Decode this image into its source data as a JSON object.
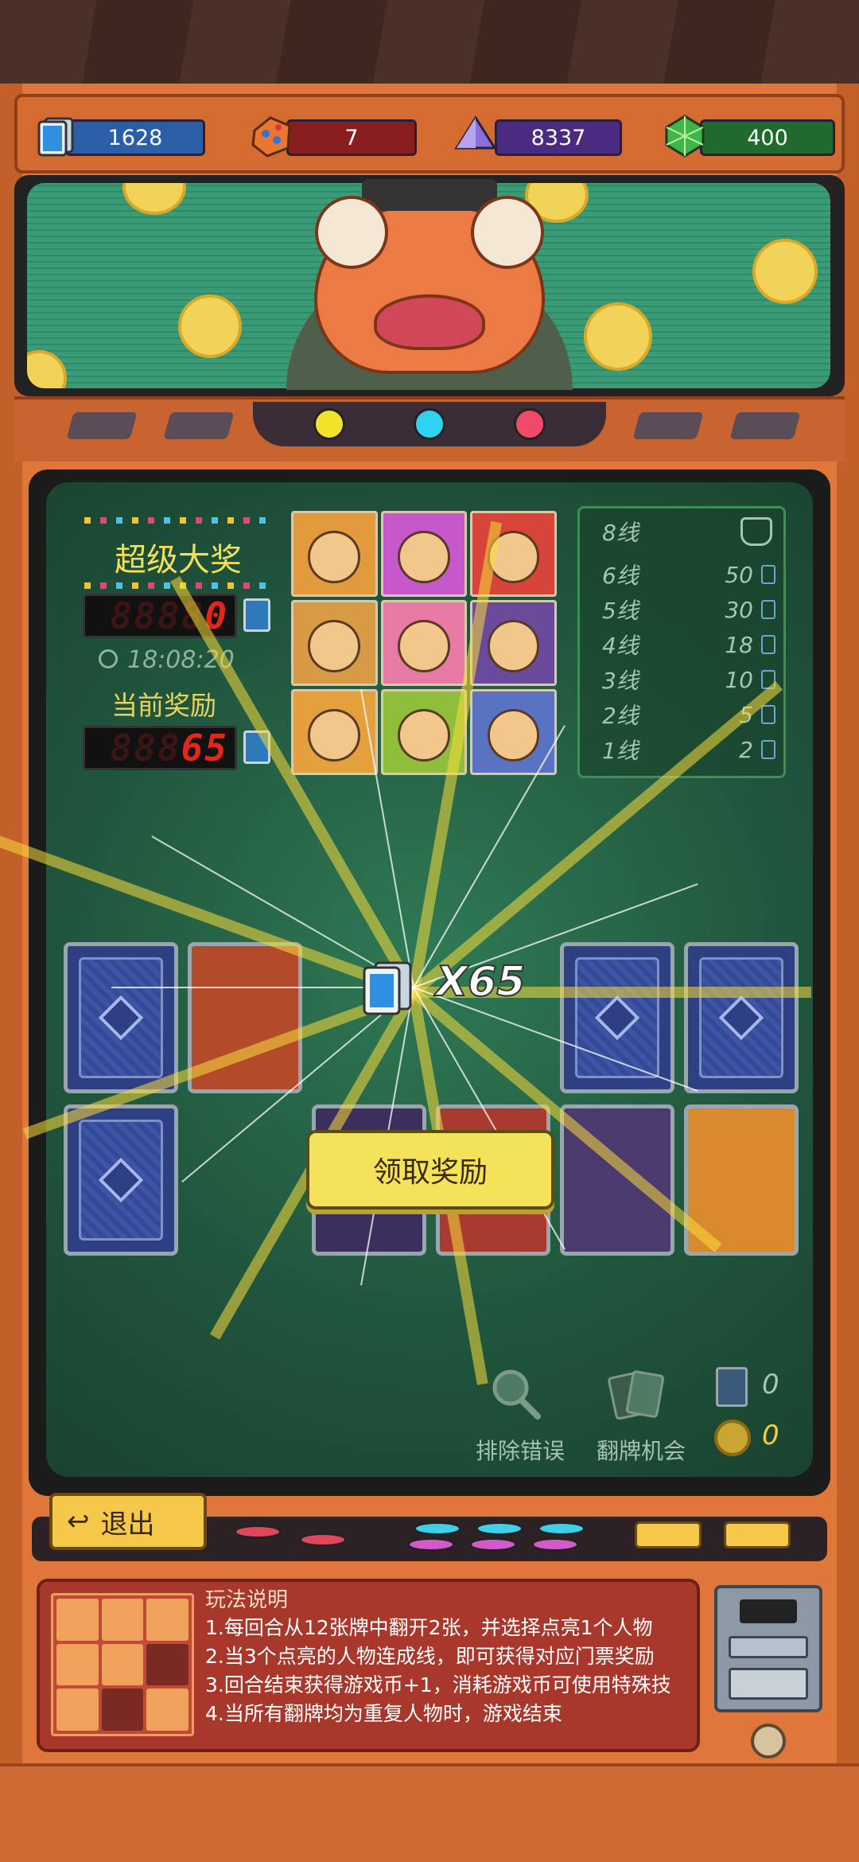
{
  "resources": {
    "tickets": "1628",
    "gems_orange": "7",
    "crystals": "8337",
    "emeralds": "400"
  },
  "jackpot": {
    "title": "超级大奖",
    "value": "0",
    "timer": "18:08:20",
    "current_label": "当前奖励",
    "current_value": "65"
  },
  "payout_table": {
    "top_label": "8线",
    "rows": [
      {
        "label": "6线",
        "value": "50"
      },
      {
        "label": "5线",
        "value": "30"
      },
      {
        "label": "4线",
        "value": "18"
      },
      {
        "label": "3线",
        "value": "10"
      },
      {
        "label": "2线",
        "value": "5"
      },
      {
        "label": "1线",
        "value": "2"
      }
    ]
  },
  "reward": {
    "multiplier": "X65",
    "claim_label": "领取奖励"
  },
  "tools": {
    "remove_error": "排除错误",
    "flip_chance": "翻牌机会",
    "ticket_count": "0",
    "coin_count": "0"
  },
  "exit_label": "退出",
  "instructions": {
    "title": "玩法说明",
    "lines": [
      "1.每回合从12张牌中翻开2张，并选择点亮1个人物",
      "2.当3个点亮的人物连成线，即可获得对应门票奖励",
      "3.回合结束获得游戏币+1，消耗游戏币可使用特殊技",
      "4.当所有翻牌均为重复人物时，游戏结束"
    ]
  },
  "colors": {
    "cabinet": "#e0773a",
    "board": "#21563e",
    "claim_button": "#f4e25a",
    "led_red": "#e3261a"
  }
}
